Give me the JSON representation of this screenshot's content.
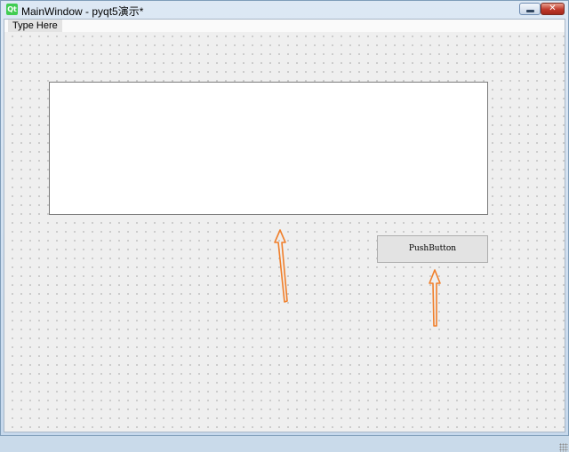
{
  "window": {
    "title": "MainWindow - pyqt5演示*",
    "logo_text": "Qt",
    "close_glyph": "✕"
  },
  "menubar": {
    "items": [
      {
        "label": "Type Here"
      }
    ]
  },
  "form": {
    "text_edit_value": "",
    "push_button_label": "PushButton"
  },
  "annotations": {
    "arrow_color": "#f07f2b",
    "arrow_count": 2
  },
  "icons": {
    "app": "qt-logo-icon",
    "minimize": "minimize-icon",
    "close": "close-icon",
    "grip": "resize-grip-icon"
  }
}
